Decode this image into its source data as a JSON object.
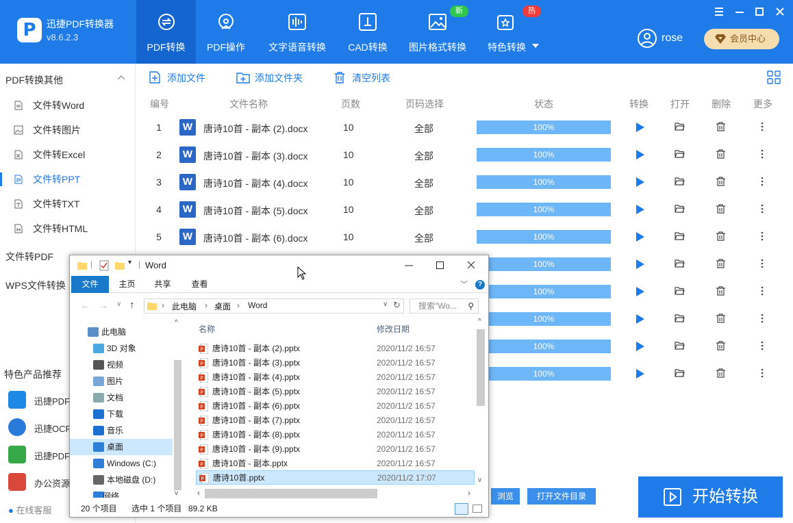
{
  "app": {
    "name": "迅捷PDF转换器",
    "version": "v8.6.2.3"
  },
  "nav": {
    "tabs": [
      {
        "label": "PDF转换"
      },
      {
        "label": "PDF操作"
      },
      {
        "label": "文字语音转换"
      },
      {
        "label": "CAD转换"
      },
      {
        "label": "图片格式转换",
        "badge": "新"
      },
      {
        "label": "特色转换",
        "badge": "热"
      }
    ]
  },
  "user": {
    "name": "rose",
    "vip_label": "会员中心"
  },
  "sidebar": {
    "section1": "PDF转换其他",
    "items": [
      {
        "label": "文件转Word"
      },
      {
        "label": "文件转图片"
      },
      {
        "label": "文件转Excel"
      },
      {
        "label": "文件转PPT"
      },
      {
        "label": "文件转TXT"
      },
      {
        "label": "文件转HTML"
      }
    ],
    "section2": "文件转PDF",
    "section3": "WPS文件转换",
    "promo_title": "特色产品推荐",
    "promos": [
      {
        "label": "迅捷PDF编"
      },
      {
        "label": "迅捷OCR"
      },
      {
        "label": "迅捷PDF压"
      },
      {
        "label": "办公资源网"
      }
    ],
    "service": "在线客服"
  },
  "toolbar": {
    "add_file": "添加文件",
    "add_folder": "添加文件夹",
    "clear": "清空列表"
  },
  "table": {
    "headers": [
      "编号",
      "文件名称",
      "页数",
      "页码选择",
      "状态",
      "转换",
      "打开",
      "删除",
      "更多"
    ],
    "rows": [
      {
        "num": "1",
        "name": "唐诗10首 - 副本 (2).docx",
        "pages": "10",
        "range": "全部",
        "progress": "100%"
      },
      {
        "num": "2",
        "name": "唐诗10首 - 副本 (3).docx",
        "pages": "10",
        "range": "全部",
        "progress": "100%"
      },
      {
        "num": "3",
        "name": "唐诗10首 - 副本 (4).docx",
        "pages": "10",
        "range": "全部",
        "progress": "100%"
      },
      {
        "num": "4",
        "name": "唐诗10首 - 副本 (5).docx",
        "pages": "10",
        "range": "全部",
        "progress": "100%"
      },
      {
        "num": "5",
        "name": "唐诗10首 - 副本 (6).docx",
        "pages": "10",
        "range": "全部",
        "progress": "100%"
      },
      {
        "progress": "100%"
      },
      {
        "progress": "100%"
      },
      {
        "progress": "100%"
      },
      {
        "progress": "100%"
      },
      {
        "progress": "100%"
      }
    ]
  },
  "bottom": {
    "browse": "浏览",
    "open_dir": "打开文件目录",
    "start": "开始转换"
  },
  "explorer": {
    "title": "Word",
    "ribbon_tabs": [
      "文件",
      "主页",
      "共享",
      "查看"
    ],
    "breadcrumb": [
      "此电脑",
      "桌面",
      "Word"
    ],
    "search_placeholder": "搜索\"Wo...",
    "nav_items": [
      {
        "label": "此电脑"
      },
      {
        "label": "3D 对象"
      },
      {
        "label": "视频"
      },
      {
        "label": "图片"
      },
      {
        "label": "文档"
      },
      {
        "label": "下载"
      },
      {
        "label": "音乐"
      },
      {
        "label": "桌面"
      },
      {
        "label": "Windows (C:)"
      },
      {
        "label": "本地磁盘 (D:)"
      },
      {
        "label": "网络"
      }
    ],
    "col_name": "名称",
    "col_date": "修改日期",
    "files": [
      {
        "name": "唐诗10首 - 副本 (2).pptx",
        "date": "2020/11/2 16:57"
      },
      {
        "name": "唐诗10首 - 副本 (3).pptx",
        "date": "2020/11/2 16:57"
      },
      {
        "name": "唐诗10首 - 副本 (4).pptx",
        "date": "2020/11/2 16:57"
      },
      {
        "name": "唐诗10首 - 副本 (5).pptx",
        "date": "2020/11/2 16:57"
      },
      {
        "name": "唐诗10首 - 副本 (6).pptx",
        "date": "2020/11/2 16:57"
      },
      {
        "name": "唐诗10首 - 副本 (7).pptx",
        "date": "2020/11/2 16:57"
      },
      {
        "name": "唐诗10首 - 副本 (8).pptx",
        "date": "2020/11/2 16:57"
      },
      {
        "name": "唐诗10首 - 副本 (9).pptx",
        "date": "2020/11/2 16:57"
      },
      {
        "name": "唐诗10首 - 副本.pptx",
        "date": "2020/11/2 16:57"
      },
      {
        "name": "唐诗10首.pptx",
        "date": "2020/11/2 17:07"
      }
    ],
    "status_count": "20 个项目",
    "status_selected": "选中 1 个项目",
    "status_size": "89.2 KB"
  },
  "colors": {
    "brand": "#1E7BE7",
    "progress": "#6DB6F7",
    "vip": "#F5DDB0",
    "badge_new": "#2DC84D",
    "badge_hot": "#F23B3B"
  }
}
